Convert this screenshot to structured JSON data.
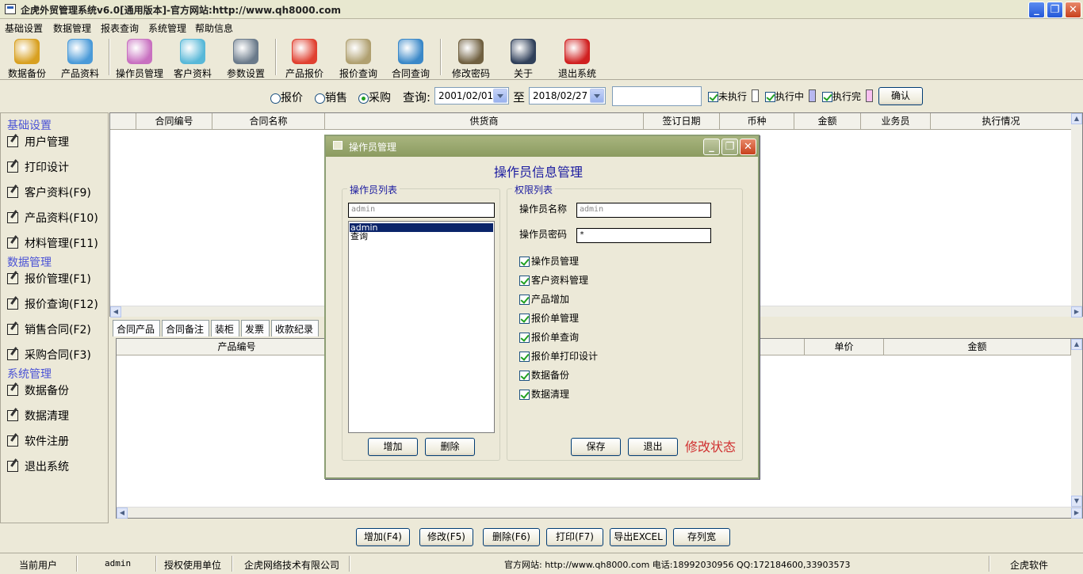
{
  "window": {
    "title": "企虎外贸管理系统v6.0[通用版本]-官方网站:http://www.qh8000.com",
    "minimize": "_",
    "restore": "❐",
    "close": "✕"
  },
  "menu": [
    "基础设置",
    "数据管理",
    "报表查询",
    "系统管理",
    "帮助信息"
  ],
  "toolbar": [
    {
      "label": "数据备份",
      "icon": "database-backup-icon",
      "color": "#d8a020"
    },
    {
      "label": "产品资料",
      "icon": "product-info-icon",
      "color": "#4a9ad8"
    },
    {
      "label": "操作员管理",
      "icon": "operator-icon",
      "color": "#c870c0"
    },
    {
      "label": "客户资料",
      "icon": "customer-icon",
      "color": "#58b8d8"
    },
    {
      "label": "参数设置",
      "icon": "settings-db-icon",
      "color": "#6a7a8a"
    },
    {
      "label": "产品报价",
      "icon": "product-quote-icon",
      "color": "#e04030"
    },
    {
      "label": "报价查询",
      "icon": "magnifier-icon",
      "color": "#b0a070"
    },
    {
      "label": "合同查询",
      "icon": "contract-search-icon",
      "color": "#3a88c8"
    },
    {
      "label": "修改密码",
      "icon": "key-icon",
      "color": "#706040"
    },
    {
      "label": "关于",
      "icon": "about-icon",
      "color": "#30405a"
    },
    {
      "label": "退出系统",
      "icon": "exit-icon",
      "color": "#d02020"
    }
  ],
  "search": {
    "radios": [
      {
        "label": "报价",
        "selected": false
      },
      {
        "label": "销售",
        "selected": false
      },
      {
        "label": "采购",
        "selected": true
      }
    ],
    "query_label": "查询:",
    "date_from": "2001/02/01",
    "to_label": "至",
    "date_to": "2018/02/27",
    "keyword": "",
    "filters": [
      {
        "label": "未执行",
        "checked": true,
        "color": "#ffffff"
      },
      {
        "label": "执行中",
        "checked": true,
        "color": "#b8b8f0"
      },
      {
        "label": "执行完",
        "checked": true,
        "color": "#f8c0f0"
      }
    ],
    "confirm": "确认"
  },
  "sidebar": [
    {
      "type": "header",
      "label": "基础设置"
    },
    {
      "type": "item",
      "label": "用户管理"
    },
    {
      "type": "item",
      "label": "打印设计"
    },
    {
      "type": "item",
      "label": "客户资料(F9)"
    },
    {
      "type": "item",
      "label": "产品资料(F10)"
    },
    {
      "type": "item",
      "label": "材料管理(F11)"
    },
    {
      "type": "header",
      "label": "数据管理"
    },
    {
      "type": "item",
      "label": "报价管理(F1)"
    },
    {
      "type": "item",
      "label": "报价查询(F12)"
    },
    {
      "type": "item",
      "label": "销售合同(F2)"
    },
    {
      "type": "item",
      "label": "采购合同(F3)"
    },
    {
      "type": "header",
      "label": "系统管理"
    },
    {
      "type": "item",
      "label": "数据备份"
    },
    {
      "type": "item",
      "label": "数据清理"
    },
    {
      "type": "item",
      "label": "软件注册"
    },
    {
      "type": "item",
      "label": "退出系统"
    }
  ],
  "contracts_table": {
    "columns": [
      "合同编号",
      "合同名称",
      "供货商",
      "签订日期",
      "币种",
      "金额",
      "业务员",
      "执行情况"
    ]
  },
  "detail_tabs": [
    "合同产品",
    "合同备注",
    "装柜",
    "发票",
    "收款纪录"
  ],
  "products_table": {
    "columns": [
      "产品编号",
      "单价",
      "金额"
    ]
  },
  "actions": [
    "增加(F4)",
    "修改(F5)",
    "删除(F6)",
    "打印(F7)",
    "导出EXCEL",
    "存列宽"
  ],
  "status": {
    "current_user_label": "当前用户",
    "current_user": "admin",
    "licensee_label": "授权使用单位",
    "licensee": "企虎网络技术有限公司",
    "contact": "官方网站: http://www.qh8000.com 电话:18992030956 QQ:172184600,33903573",
    "brand": "企虎软件"
  },
  "dialog": {
    "title": "操作员管理",
    "heading": "操作员信息管理",
    "operators_group": "操作员列表",
    "operator_search": "admin",
    "operators": [
      {
        "name": "admin",
        "selected": true
      },
      {
        "name": "查询",
        "selected": false
      }
    ],
    "add": "增加",
    "delete": "删除",
    "permissions_group": "权限列表",
    "name_label": "操作员名称",
    "name_value": "admin",
    "password_label": "操作员密码",
    "password_value": "*",
    "permissions": [
      {
        "label": "操作员管理",
        "checked": true
      },
      {
        "label": "客户资料管理",
        "checked": true
      },
      {
        "label": "产品增加",
        "checked": true
      },
      {
        "label": "报价单管理",
        "checked": true
      },
      {
        "label": "报价单查询",
        "checked": true
      },
      {
        "label": "报价单打印设计",
        "checked": true
      },
      {
        "label": "数据备份",
        "checked": true
      },
      {
        "label": "数据清理",
        "checked": true
      }
    ],
    "save": "保存",
    "exit": "退出",
    "mode": "修改状态"
  }
}
